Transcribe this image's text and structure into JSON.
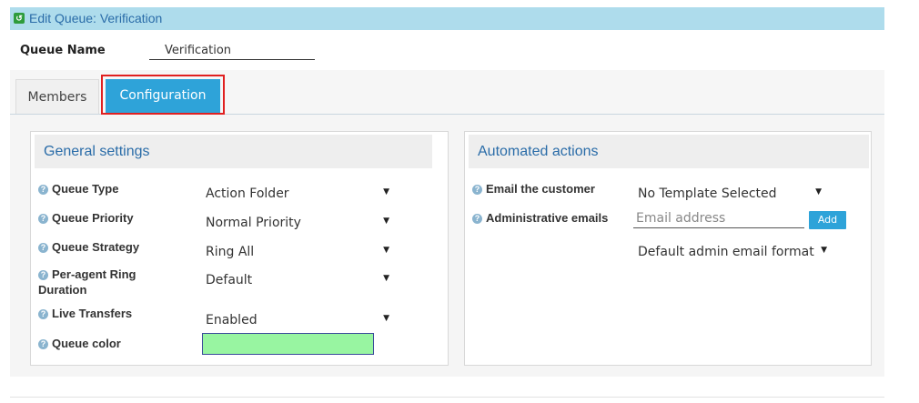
{
  "header": {
    "title": "Edit Queue: Verification",
    "icon": "share-icon"
  },
  "queue_name": {
    "label": "Queue Name",
    "value": "Verification"
  },
  "tabs": [
    {
      "label": "Members",
      "active": false
    },
    {
      "label": "Configuration",
      "active": true
    }
  ],
  "general": {
    "title": "General settings",
    "rows": [
      {
        "label": "Queue Type",
        "value": "Action Folder"
      },
      {
        "label": "Queue Priority",
        "value": "Normal Priority"
      },
      {
        "label": "Queue Strategy",
        "value": "Ring All"
      },
      {
        "label_line1": "Per-agent Ring",
        "label_line2": "Duration",
        "value": "Default"
      },
      {
        "label": "Live Transfers",
        "value": "Enabled"
      },
      {
        "label": "Queue color",
        "color": "#98f5a1"
      }
    ]
  },
  "automated": {
    "title": "Automated actions",
    "email_customer_label": "Email the customer",
    "email_customer_value": "No Template Selected",
    "admin_emails_label": "Administrative emails",
    "email_placeholder": "Email address",
    "add_label": "Add",
    "format_value": "Default admin email format"
  },
  "colors": {
    "accent": "#2ea3d9",
    "title_bar": "#aedcec",
    "heading_text": "#2a6ca8",
    "highlight": "#e02020"
  }
}
